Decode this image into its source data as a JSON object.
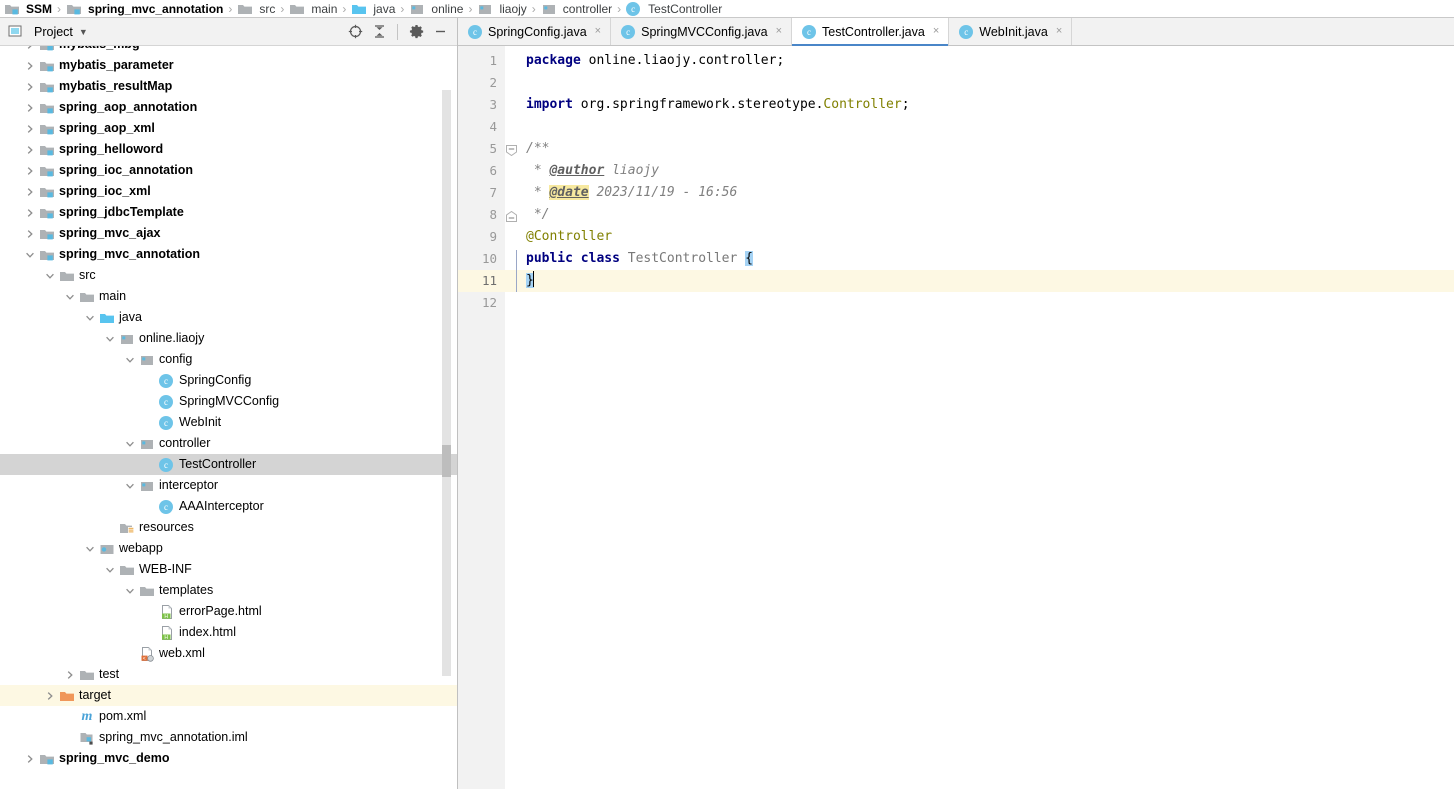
{
  "breadcrumb": {
    "items": [
      {
        "label": "SSM",
        "icon": "module-icon",
        "bold": true
      },
      {
        "label": "spring_mvc_annotation",
        "icon": "module-icon",
        "bold": true
      },
      {
        "label": "src",
        "icon": "folder-icon",
        "bold": false
      },
      {
        "label": "main",
        "icon": "folder-icon",
        "bold": false
      },
      {
        "label": "java",
        "icon": "source-folder-icon",
        "bold": false
      },
      {
        "label": "online",
        "icon": "package-icon",
        "bold": false
      },
      {
        "label": "liaojy",
        "icon": "package-icon",
        "bold": false
      },
      {
        "label": "controller",
        "icon": "package-icon",
        "bold": false
      },
      {
        "label": "TestController",
        "icon": "class-icon",
        "bold": false
      }
    ],
    "separator": "›"
  },
  "project_panel": {
    "title": "Project",
    "dropdown_glyph": "▼",
    "toolbar_icons": [
      {
        "name": "select-opened-file-icon",
        "title": "Select Opened File"
      },
      {
        "name": "collapse-all-icon",
        "title": "Collapse All"
      },
      {
        "name": "gear-icon",
        "title": "Settings"
      },
      {
        "name": "hide-icon",
        "title": "Hide"
      }
    ],
    "tree": [
      {
        "label": "mybatis_mbg",
        "indent": 1,
        "arrow": "right",
        "icon": "module-icon",
        "bold": true,
        "state": "normal"
      },
      {
        "label": "mybatis_parameter",
        "indent": 1,
        "arrow": "right",
        "icon": "module-icon",
        "bold": true,
        "state": "normal"
      },
      {
        "label": "mybatis_resultMap",
        "indent": 1,
        "arrow": "right",
        "icon": "module-icon",
        "bold": true,
        "state": "normal"
      },
      {
        "label": "spring_aop_annotation",
        "indent": 1,
        "arrow": "right",
        "icon": "module-icon",
        "bold": true,
        "state": "normal"
      },
      {
        "label": "spring_aop_xml",
        "indent": 1,
        "arrow": "right",
        "icon": "module-icon",
        "bold": true,
        "state": "normal"
      },
      {
        "label": "spring_helloword",
        "indent": 1,
        "arrow": "right",
        "icon": "module-icon",
        "bold": true,
        "state": "normal"
      },
      {
        "label": "spring_ioc_annotation",
        "indent": 1,
        "arrow": "right",
        "icon": "module-icon",
        "bold": true,
        "state": "normal"
      },
      {
        "label": "spring_ioc_xml",
        "indent": 1,
        "arrow": "right",
        "icon": "module-icon",
        "bold": true,
        "state": "normal"
      },
      {
        "label": "spring_jdbcTemplate",
        "indent": 1,
        "arrow": "right",
        "icon": "module-icon",
        "bold": true,
        "state": "normal"
      },
      {
        "label": "spring_mvc_ajax",
        "indent": 1,
        "arrow": "right",
        "icon": "module-icon",
        "bold": true,
        "state": "normal"
      },
      {
        "label": "spring_mvc_annotation",
        "indent": 1,
        "arrow": "down",
        "icon": "module-icon",
        "bold": true,
        "state": "normal"
      },
      {
        "label": "src",
        "indent": 2,
        "arrow": "down",
        "icon": "folder-icon",
        "bold": false,
        "state": "normal"
      },
      {
        "label": "main",
        "indent": 3,
        "arrow": "down",
        "icon": "folder-icon",
        "bold": false,
        "state": "normal"
      },
      {
        "label": "java",
        "indent": 4,
        "arrow": "down",
        "icon": "source-folder-icon",
        "bold": false,
        "state": "normal"
      },
      {
        "label": "online.liaojy",
        "indent": 5,
        "arrow": "down",
        "icon": "package-icon",
        "bold": false,
        "state": "normal"
      },
      {
        "label": "config",
        "indent": 6,
        "arrow": "down",
        "icon": "package-icon",
        "bold": false,
        "state": "normal"
      },
      {
        "label": "SpringConfig",
        "indent": 7,
        "arrow": "none",
        "icon": "class-icon",
        "bold": false,
        "state": "normal"
      },
      {
        "label": "SpringMVCConfig",
        "indent": 7,
        "arrow": "none",
        "icon": "class-icon",
        "bold": false,
        "state": "normal"
      },
      {
        "label": "WebInit",
        "indent": 7,
        "arrow": "none",
        "icon": "class-icon",
        "bold": false,
        "state": "normal"
      },
      {
        "label": "controller",
        "indent": 6,
        "arrow": "down",
        "icon": "package-icon",
        "bold": false,
        "state": "normal"
      },
      {
        "label": "TestController",
        "indent": 7,
        "arrow": "none",
        "icon": "class-icon",
        "bold": false,
        "state": "selected"
      },
      {
        "label": "interceptor",
        "indent": 6,
        "arrow": "down",
        "icon": "package-icon",
        "bold": false,
        "state": "normal"
      },
      {
        "label": "AAAInterceptor",
        "indent": 7,
        "arrow": "none",
        "icon": "class-icon",
        "bold": false,
        "state": "normal"
      },
      {
        "label": "resources",
        "indent": 5,
        "arrow": "none",
        "icon": "resources-folder-icon",
        "bold": false,
        "state": "normal"
      },
      {
        "label": "webapp",
        "indent": 4,
        "arrow": "down",
        "icon": "webapp-icon",
        "bold": false,
        "state": "normal"
      },
      {
        "label": "WEB-INF",
        "indent": 5,
        "arrow": "down",
        "icon": "folder-icon",
        "bold": false,
        "state": "normal"
      },
      {
        "label": "templates",
        "indent": 6,
        "arrow": "down",
        "icon": "folder-icon",
        "bold": false,
        "state": "normal"
      },
      {
        "label": "errorPage.html",
        "indent": 7,
        "arrow": "none",
        "icon": "html-file-icon",
        "bold": false,
        "state": "normal"
      },
      {
        "label": "index.html",
        "indent": 7,
        "arrow": "none",
        "icon": "html-file-icon",
        "bold": false,
        "state": "normal"
      },
      {
        "label": "web.xml",
        "indent": 6,
        "arrow": "none",
        "icon": "webxml-file-icon",
        "bold": false,
        "state": "normal"
      },
      {
        "label": "test",
        "indent": 3,
        "arrow": "right",
        "icon": "folder-icon",
        "bold": false,
        "state": "normal"
      },
      {
        "label": "target",
        "indent": 2,
        "arrow": "right",
        "icon": "excluded-folder-icon",
        "bold": false,
        "state": "highlight"
      },
      {
        "label": "pom.xml",
        "indent": 3,
        "arrow": "none",
        "icon": "maven-file-icon",
        "bold": false,
        "state": "normal"
      },
      {
        "label": "spring_mvc_annotation.iml",
        "indent": 3,
        "arrow": "none",
        "icon": "iml-file-icon",
        "bold": false,
        "state": "normal"
      },
      {
        "label": "spring_mvc_demo",
        "indent": 1,
        "arrow": "right",
        "icon": "module-icon",
        "bold": true,
        "state": "normal"
      }
    ]
  },
  "editor": {
    "tabs": [
      {
        "label": "SpringConfig.java",
        "icon": "class-icon",
        "active": false,
        "close_glyph": "×"
      },
      {
        "label": "SpringMVCConfig.java",
        "icon": "class-icon",
        "active": false,
        "close_glyph": "×"
      },
      {
        "label": "TestController.java",
        "icon": "class-icon",
        "active": true,
        "close_glyph": "×"
      },
      {
        "label": "WebInit.java",
        "icon": "class-icon",
        "active": false,
        "close_glyph": "×"
      }
    ],
    "line_numbers": [
      "1",
      "2",
      "3",
      "4",
      "5",
      "6",
      "7",
      "8",
      "9",
      "10",
      "11",
      "12"
    ],
    "current_line": 11,
    "code_lines": [
      {
        "n": 1,
        "text": "package online.liaojy.controller;"
      },
      {
        "n": 2,
        "text": ""
      },
      {
        "n": 3,
        "text": "import org.springframework.stereotype.Controller;"
      },
      {
        "n": 4,
        "text": ""
      },
      {
        "n": 5,
        "text": "/**"
      },
      {
        "n": 6,
        "text": " * @author liaojy"
      },
      {
        "n": 7,
        "text": " * @date 2023/11/19 - 16:56"
      },
      {
        "n": 8,
        "text": " */"
      },
      {
        "n": 9,
        "text": "@Controller"
      },
      {
        "n": 10,
        "text": "public class TestController {"
      },
      {
        "n": 11,
        "text": "}"
      },
      {
        "n": 12,
        "text": ""
      }
    ]
  },
  "colors": {
    "accent": "#4a86c8",
    "class_icon": "#6ec4e8",
    "keyword": "#000080",
    "annotation": "#808000",
    "comment": "#808080",
    "selection": "#d4d4d4",
    "current_line": "#fdf8e3",
    "brace_match": "#a5d3f5",
    "excluded_folder": "#f0975a"
  }
}
